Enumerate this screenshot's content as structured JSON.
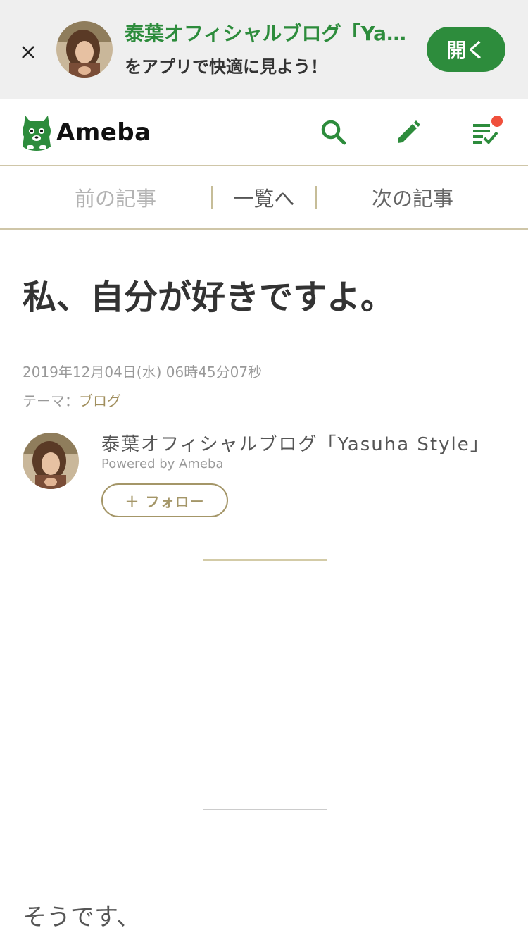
{
  "banner": {
    "title": "泰葉オフィシャルブログ「Yasuha Style」",
    "subtitle": "をアプリで快適に見よう！",
    "open_label": "開く"
  },
  "header": {
    "logo_text": "Ameba",
    "brand_color": "#2d8c3c",
    "notification_color": "#f0503c"
  },
  "pager": {
    "prev_label": "前の記事",
    "list_label": "一覧へ",
    "next_label": "次の記事"
  },
  "article": {
    "title": "私、自分が好きですよ。",
    "datetime": "2019年12月04日(水) 06時45分07秒",
    "theme_prefix": "テーマ：",
    "theme_link": "ブログ",
    "body_first_line": "そうです、"
  },
  "author": {
    "blog_name": "泰葉オフィシャルブログ「Yasuha Style」",
    "powered": "Powered by Ameba",
    "follow_label": "＋ フォロー"
  }
}
